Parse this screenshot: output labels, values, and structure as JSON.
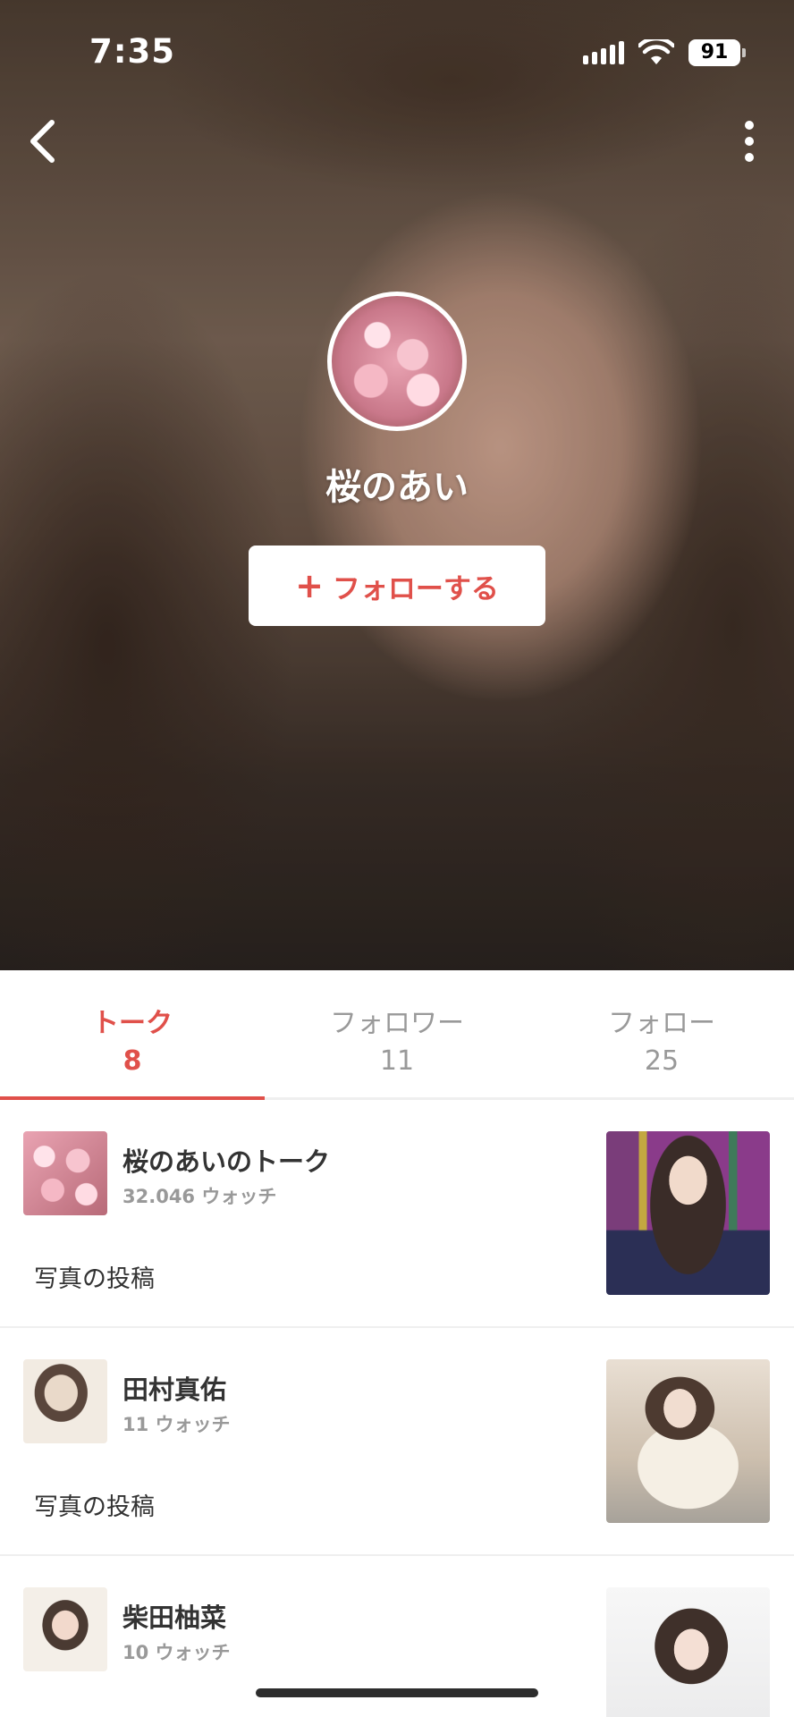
{
  "status_bar": {
    "time": "7:35",
    "battery": "91"
  },
  "profile": {
    "name": "桜のあい",
    "follow_label": "フォローする",
    "follow_icon": "plus-icon"
  },
  "colors": {
    "accent": "#e0504a",
    "muted_text": "#999999"
  },
  "tabs": [
    {
      "label": "トーク",
      "count": "8",
      "active": true
    },
    {
      "label": "フォロワー",
      "count": "11",
      "active": false
    },
    {
      "label": "フォロー",
      "count": "25",
      "active": false
    }
  ],
  "items": [
    {
      "title": "桜のあいのトーク",
      "watch": "32.046 ウォッチ",
      "desc": "写真の投稿"
    },
    {
      "title": "田村真佑",
      "watch": "11 ウォッチ",
      "desc": "写真の投稿"
    },
    {
      "title": "柴田柚菜",
      "watch": "10 ウォッチ",
      "desc": ""
    }
  ]
}
